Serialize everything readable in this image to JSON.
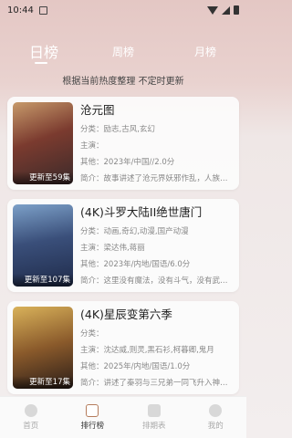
{
  "status": {
    "time": "10:44"
  },
  "tabs": [
    {
      "label": "日榜",
      "active": true
    },
    {
      "label": "周榜",
      "active": false
    },
    {
      "label": "月榜",
      "active": false
    }
  ],
  "subtitle": "根据当前热度整理 不定时更新",
  "items": [
    {
      "title": "沧元图",
      "category": "分类：励志,古风,玄幻",
      "cast": "主演：",
      "other": "其他：2023年/中国//2.0分",
      "summary": "简介：故事讲述了沧元界妖邪作乱，人族…",
      "badge": "更新至59集",
      "poster_colors": [
        "#3b2a2a",
        "#7b3b2f",
        "#c79a6b"
      ]
    },
    {
      "title": "(4K)斗罗大陆II绝世唐门",
      "category": "分类：动画,奇幻,动漫,国产动漫",
      "cast": "主演：梁达伟,蒋丽",
      "other": "其他：2023年/内地/国语/6.0分",
      "summary": "简介：这里没有魔法，没有斗气，没有武…",
      "badge": "更新至107集",
      "poster_colors": [
        "#1f2b4a",
        "#3a4f7a",
        "#7ca0c8"
      ]
    },
    {
      "title": "(4K)星辰变第六季",
      "category": "分类：",
      "cast": "主演：沈达威,则灵,黑石衫,柯暮卿,鬼月",
      "other": "其他：2025年/内地/国语/1.0分",
      "summary": "简介：讲述了秦羽与三兄弟一同飞升入神…",
      "badge": "更新至17集",
      "poster_colors": [
        "#2b1d18",
        "#8a5a2b",
        "#d9b25a"
      ]
    }
  ],
  "nav": [
    {
      "label": "首页",
      "active": false,
      "icon": "home-icon"
    },
    {
      "label": "排行榜",
      "active": true,
      "icon": "ranking-icon"
    },
    {
      "label": "排期表",
      "active": false,
      "icon": "calendar-icon"
    },
    {
      "label": "我的",
      "active": false,
      "icon": "profile-icon"
    }
  ]
}
